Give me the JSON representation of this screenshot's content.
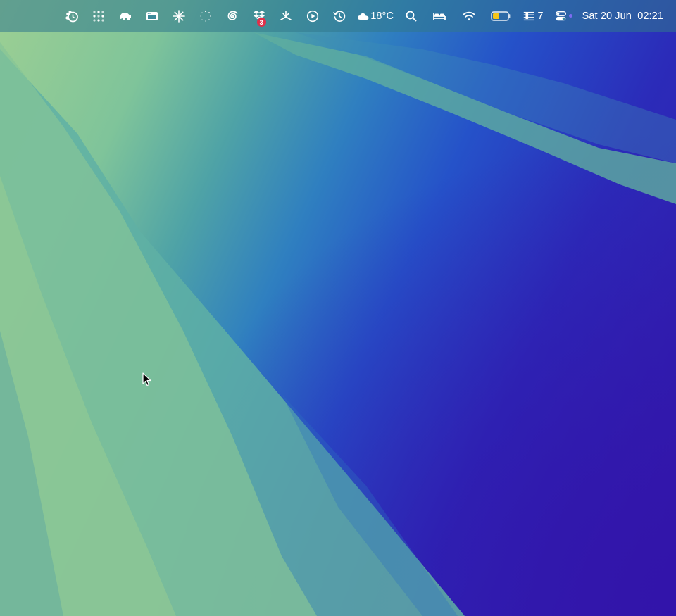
{
  "menubar": {
    "icons": [
      "screen-time-icon",
      "grid-dots-icon",
      "elephant-icon",
      "window-icon",
      "sparkle-icon",
      "loading-spinner-icon",
      "spiral-icon",
      "dropbox-icon",
      "fan-icon",
      "play-icon",
      "time-machine-icon",
      "weather-cloud-icon",
      "search-icon",
      "bed-icon",
      "wifi-icon",
      "battery-icon",
      "menu-list-icon",
      "control-center-icon"
    ],
    "dropbox_badge": "3",
    "weather_temp": "18°C",
    "menu_count": "7",
    "datetime": "Sat 20 Jun  02:21"
  },
  "colors": {
    "battery_fill": "#f5c518",
    "badge": "#e0304a",
    "menubar_bg": "rgba(50,120,140,0.55)"
  }
}
